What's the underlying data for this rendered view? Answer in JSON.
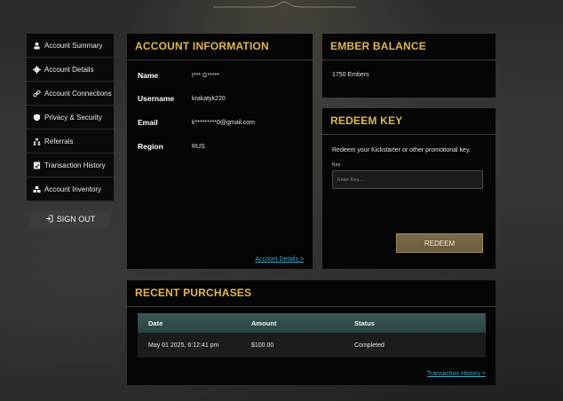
{
  "sidebar": {
    "items": [
      {
        "label": "Account Summary",
        "icon": "user-icon"
      },
      {
        "label": "Account Details",
        "icon": "gear-icon"
      },
      {
        "label": "Account Connections",
        "icon": "link-icon"
      },
      {
        "label": "Privacy & Security",
        "icon": "shield-icon"
      },
      {
        "label": "Referrals",
        "icon": "users-icon"
      },
      {
        "label": "Transaction History",
        "icon": "receipt-icon"
      },
      {
        "label": "Account Inventory",
        "icon": "boxes-icon"
      }
    ],
    "signout_label": "SIGN OUT"
  },
  "account": {
    "title": "ACCOUNT INFORMATION",
    "fields": [
      {
        "label": "Name",
        "value": "I*** G*****"
      },
      {
        "label": "Username",
        "value": "krakatyk220"
      },
      {
        "label": "Email",
        "value": "k*********0@gmail.com"
      },
      {
        "label": "Region",
        "value": "RUS"
      }
    ],
    "link": "Account Details >"
  },
  "ember": {
    "title": "EMBER BALANCE",
    "amount": "1750  Embers"
  },
  "redeem": {
    "title": "REDEEM KEY",
    "description": "Redeem your Kickstarter or other promotional key.",
    "key_label": "Key",
    "key_placeholder": "Enter Key...",
    "key_value": "",
    "button": "REDEEM"
  },
  "recent": {
    "title": "RECENT PURCHASES",
    "columns": [
      "Date",
      "Amount",
      "Status"
    ],
    "rows": [
      {
        "date": "May 01 2025, 6:12:41 pm",
        "amount": "$100.00",
        "status": "Completed"
      }
    ],
    "link": "Transaction History >"
  },
  "colors": {
    "accent_gold": "#e0b64d",
    "link_blue": "#3fa8c9",
    "table_header_teal": "#3a5656",
    "redeem_button": "#7a6b49"
  }
}
